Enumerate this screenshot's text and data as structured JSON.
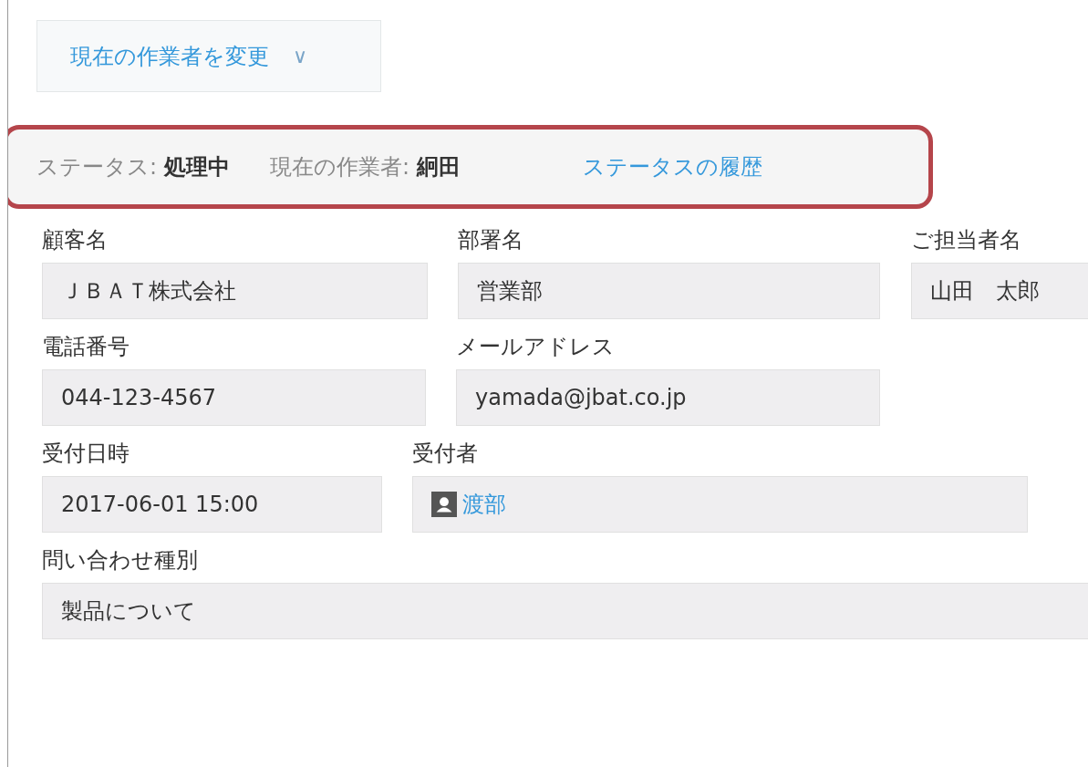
{
  "action_button": {
    "label": "現在の作業者を変更",
    "icon": "∨"
  },
  "status_bar": {
    "highlighted": true,
    "items": [
      {
        "label": "ステータス:",
        "value": "処理中"
      },
      {
        "label": "現在の作業者:",
        "value": "絅田"
      }
    ],
    "history_link": "ステータスの履歴"
  },
  "rows": [
    {
      "fields": [
        {
          "label": "顧客名",
          "value": "ＪＢＡＴ株式会社",
          "kind": "text"
        },
        {
          "label": "部署名",
          "value": "営業部",
          "kind": "text"
        },
        {
          "label": "ご担当者名",
          "value": "山田　太郎",
          "kind": "text"
        }
      ]
    },
    {
      "fields": [
        {
          "label": "電話番号",
          "value": "044-123-4567",
          "kind": "text"
        },
        {
          "label": "メールアドレス",
          "value": "yamada@jbat.co.jp",
          "kind": "text"
        }
      ]
    },
    {
      "fields": [
        {
          "label": "受付日時",
          "value": "2017-06-01 15:00",
          "kind": "text"
        },
        {
          "label": "受付者",
          "value": "渡部",
          "kind": "user"
        }
      ]
    },
    {
      "fields": [
        {
          "label": "問い合わせ種別",
          "value": "製品について",
          "kind": "text"
        }
      ]
    }
  ]
}
